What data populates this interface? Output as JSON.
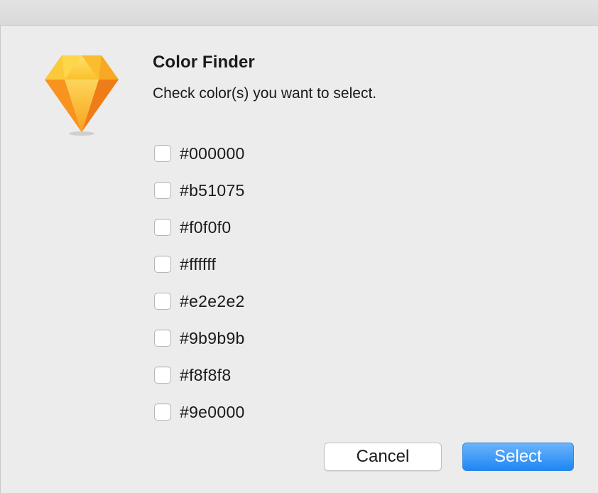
{
  "dialog": {
    "title": "Color Finder",
    "message": "Check color(s) you want to select.",
    "options": [
      {
        "label": "#000000",
        "checked": false
      },
      {
        "label": "#b51075",
        "checked": false
      },
      {
        "label": "#f0f0f0",
        "checked": false
      },
      {
        "label": "#ffffff",
        "checked": false
      },
      {
        "label": "#e2e2e2",
        "checked": false
      },
      {
        "label": "#9b9b9b",
        "checked": false
      },
      {
        "label": "#f8f8f8",
        "checked": false
      },
      {
        "label": "#9e0000",
        "checked": false
      }
    ],
    "cancel_label": "Cancel",
    "select_label": "Select"
  },
  "icons": {
    "app_icon": "sketch-diamond-icon"
  },
  "colors": {
    "accent": "#1e87f5",
    "background": "#ececec",
    "icon_orange": "#f7931e",
    "icon_yellow": "#fdd231"
  }
}
